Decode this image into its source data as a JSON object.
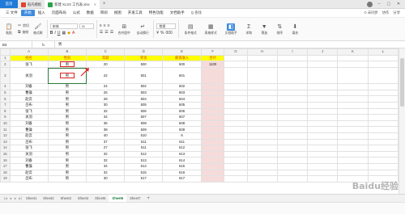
{
  "titlebar": {
    "home": "首页",
    "tabs": [
      {
        "label": "稻壳模板",
        "active": false
      },
      {
        "label": "新建 XLSX 工作表.xlsx",
        "active": true
      }
    ],
    "plus": "+"
  },
  "menubar": {
    "file": "三 文件",
    "items": [
      "开始",
      "插入",
      "页面布局",
      "公式",
      "数据",
      "审阅",
      "视图",
      "开发工具",
      "特色功能",
      "文档助手"
    ],
    "active_index": 0,
    "search": "Q 查找",
    "right": [
      "⊙ 未同步",
      "协作",
      "分享"
    ]
  },
  "toolbar": {
    "paste": "粘贴",
    "cut": "剪切",
    "copy": "复制",
    "format_painter": "格式刷",
    "font": "宋体",
    "font_size": "11",
    "bold": "B",
    "italic": "I",
    "underline": "U",
    "merge": "合并居中",
    "wrap": "自动换行",
    "number_format": "常规",
    "cond_format": "条件格式",
    "table_style": "表格样式",
    "doc_helper": "文档助手",
    "sum": "求和",
    "filter": "筛选",
    "sort": "排序",
    "fill": "填充"
  },
  "formula_bar": {
    "name_box": "B3",
    "fx": "fx",
    "content": "男"
  },
  "grid": {
    "col_headers": [
      "A",
      "B",
      "C",
      "D",
      "E",
      "F",
      "G",
      "H",
      "I",
      "J",
      "K",
      "L"
    ],
    "header_row": [
      "姓名",
      "性别",
      "年龄",
      "奖金",
      "薪资收入",
      "合计"
    ],
    "total_value": "1100",
    "rows": [
      {
        "num": "2",
        "cells": [
          "张飞",
          "男",
          "20",
          "500",
          "600"
        ]
      },
      {
        "num": "3",
        "cells": [
          "关羽",
          "男",
          "22",
          "501",
          "601"
        ]
      },
      {
        "num": "4",
        "cells": [
          "刘备",
          "男",
          "24",
          "502",
          "602"
        ]
      },
      {
        "num": "5",
        "cells": [
          "曹操",
          "男",
          "26",
          "503",
          "603"
        ]
      },
      {
        "num": "6",
        "cells": [
          "赵云",
          "男",
          "28",
          "504",
          "604"
        ]
      },
      {
        "num": "7",
        "cells": [
          "吕布",
          "男",
          "30",
          "505",
          "605"
        ]
      },
      {
        "num": "8",
        "cells": [
          "张飞",
          "男",
          "32",
          "506",
          "606"
        ]
      },
      {
        "num": "9",
        "cells": [
          "关羽",
          "男",
          "34",
          "507",
          "607"
        ]
      },
      {
        "num": "10",
        "cells": [
          "刘备",
          "男",
          "36",
          "508",
          "608"
        ]
      },
      {
        "num": "11",
        "cells": [
          "曹操",
          "男",
          "38",
          "509",
          "609"
        ]
      },
      {
        "num": "12",
        "cells": [
          "赵云",
          "男",
          "40",
          "510",
          "6"
        ]
      },
      {
        "num": "13",
        "cells": [
          "吕布",
          "男",
          "37",
          "511",
          "611"
        ]
      },
      {
        "num": "14",
        "cells": [
          "张飞",
          "男",
          "27",
          "511",
          "612"
        ]
      },
      {
        "num": "15",
        "cells": [
          "关羽",
          "男",
          "32",
          "512",
          "613"
        ]
      },
      {
        "num": "16",
        "cells": [
          "刘备",
          "男",
          "32",
          "513",
          "614"
        ]
      },
      {
        "num": "17",
        "cells": [
          "曹操",
          "男",
          "34",
          "514",
          "615"
        ]
      },
      {
        "num": "18",
        "cells": [
          "赵云",
          "男",
          "32",
          "515",
          "616"
        ]
      },
      {
        "num": "19",
        "cells": [
          "吕布",
          "男",
          "30",
          "517",
          "617"
        ]
      }
    ]
  },
  "sheet_tabs": {
    "tabs": [
      "Sheet1",
      "Sheet2",
      "Sheet3",
      "Sheet4",
      "Sheet5",
      "Sheet6",
      "Sheet7"
    ],
    "active_index": 5,
    "add": "+"
  },
  "watermark": "Baidu经验",
  "colors": {
    "header_fill": "#ffff00",
    "header_text": "#d04000",
    "total_fill": "#f6dbdb",
    "accent": "#3e8be0",
    "active_sheet": "#1a7d3a"
  }
}
